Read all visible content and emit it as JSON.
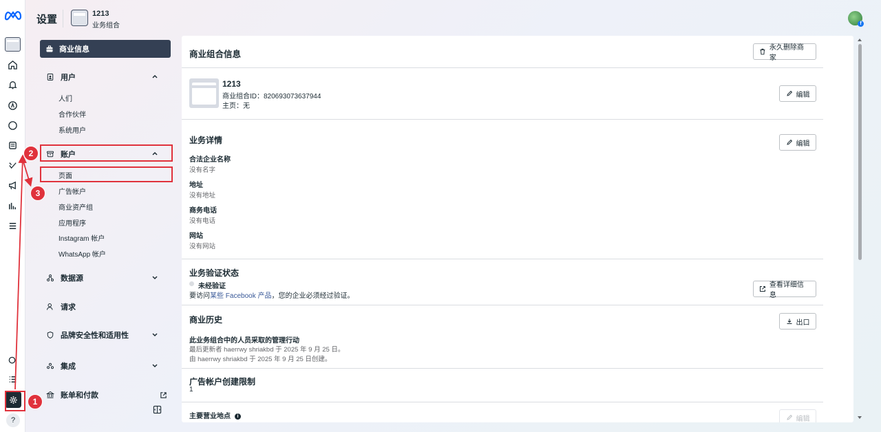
{
  "header": {
    "title": "设置",
    "business_name": "1213",
    "business_type": "业务组合"
  },
  "sidebar": {
    "active_item": "商业信息",
    "users": {
      "label": "用户",
      "items": [
        "人们",
        "合作伙伴",
        "系统用户"
      ]
    },
    "accounts": {
      "label": "账户",
      "items": [
        "页面",
        "广告帐户",
        "商业资产组",
        "应用程序",
        "Instagram 帐户",
        "WhatsApp 帐户"
      ]
    },
    "data_sources": "数据源",
    "requests": "请求",
    "brand_safety": "品牌安全性和适用性",
    "integrations": "集成",
    "billing": "账单和付款"
  },
  "rail": {
    "help": "?"
  },
  "annotations": [
    "1",
    "2",
    "3"
  ],
  "main": {
    "title": "商业组合信息",
    "delete_button": "永久删除商家",
    "business": {
      "name": "1213",
      "id_line": "商业组合ID：820693073637944",
      "homepage_line": "主页：无",
      "edit_label": "编辑"
    },
    "details": {
      "title": "业务详情",
      "edit_label": "编辑",
      "legal_name_label": "合法企业名称",
      "legal_name_value": "没有名字",
      "address_label": "地址",
      "address_value": "没有地址",
      "phone_label": "商务电话",
      "phone_value": "没有电话",
      "website_label": "网站",
      "website_value": "没有网站"
    },
    "verification": {
      "title": "业务验证状态",
      "status": "未经验证",
      "note_prefix": "要访问",
      "note_link": "某些 Facebook 产品",
      "note_suffix": "，您的企业必须经过验证。",
      "button": "查看详细信息"
    },
    "history": {
      "title": "商业历史",
      "export_button": "出口",
      "subtitle": "此业务组合中的人员采取的管理行动",
      "line1": "最后更新者 haerrwy shriakbd 于 2025 年 9 月 25 日。",
      "line2": "由 haerrwy shriakbd 于 2025 年 9 月 25 日创建。"
    },
    "ad_limit": {
      "title": "广告帐户创建限制",
      "value": "1"
    },
    "location": {
      "title": "主要营业地点",
      "edit_label": "编辑"
    }
  }
}
